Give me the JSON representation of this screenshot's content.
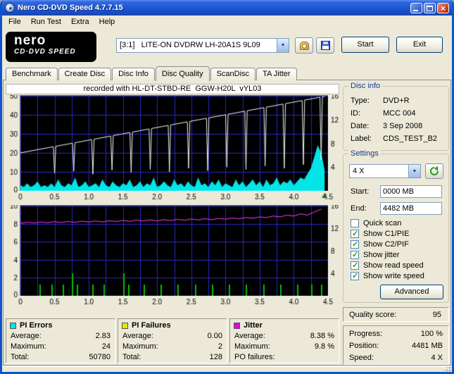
{
  "window": {
    "title": "Nero CD-DVD Speed 4.7.7.15"
  },
  "menu": {
    "items": [
      "File",
      "Run Test",
      "Extra",
      "Help"
    ]
  },
  "toolbar": {
    "logo_top": "nero",
    "logo_bottom": "CD·DVD SPEED",
    "drive_selector": "[3:1]   LITE-ON DVDRW LH-20A1S 9L09",
    "start_label": "Start",
    "exit_label": "Exit"
  },
  "tabs": [
    "Benchmark",
    "Create Disc",
    "Disc Info",
    "Disc Quality",
    "ScanDisc",
    "TA Jitter"
  ],
  "chart_header": "recorded with HL-DT-STBD-RE  GGW-H20L  vYL03",
  "disc_info": {
    "title": "Disc info",
    "rows": [
      {
        "label": "Type:",
        "value": "DVD+R"
      },
      {
        "label": "ID:",
        "value": "MCC 004"
      },
      {
        "label": "Date:",
        "value": "3 Sep 2008"
      },
      {
        "label": "Label:",
        "value": "CDS_TEST_B2"
      }
    ]
  },
  "settings": {
    "title": "Settings",
    "speed_selector": "4 X",
    "start_label": "Start:",
    "start_value": "0000 MB",
    "end_label": "End:",
    "end_value": "4482 MB",
    "checkboxes": [
      {
        "label": "Quick scan",
        "checked": false
      },
      {
        "label": "Show C1/PIE",
        "checked": true
      },
      {
        "label": "Show C2/PIF",
        "checked": true
      },
      {
        "label": "Show jitter",
        "checked": true
      },
      {
        "label": "Show read speed",
        "checked": true
      },
      {
        "label": "Show write speed",
        "checked": true
      }
    ],
    "advanced_label": "Advanced"
  },
  "quality": {
    "label": "Quality score:",
    "value": "95"
  },
  "progress": {
    "rows": [
      {
        "label": "Progress:",
        "value": "100 %"
      },
      {
        "label": "Position:",
        "value": "4481 MB"
      },
      {
        "label": "Speed:",
        "value": "4 X"
      }
    ]
  },
  "stats_panels": [
    {
      "name": "PI Errors",
      "color": "#00E6E6",
      "rows": [
        {
          "label": "Average:",
          "value": "2.83"
        },
        {
          "label": "Maximum:",
          "value": "24"
        },
        {
          "label": "Total:",
          "value": "50780"
        }
      ]
    },
    {
      "name": "PI Failures",
      "color": "#E6E600",
      "rows": [
        {
          "label": "Average:",
          "value": "0.00"
        },
        {
          "label": "Maximum:",
          "value": "2"
        },
        {
          "label": "Total:",
          "value": "128"
        }
      ]
    },
    {
      "name": "Jitter",
      "color": "#E600E6",
      "rows": [
        {
          "label": "Average:",
          "value": "8.38 %"
        },
        {
          "label": "Maximum:",
          "value": "9.8 %"
        },
        {
          "label": "PO failures:",
          "value": ""
        }
      ]
    }
  ],
  "chart_data": [
    {
      "type": "area+line",
      "title": "PI Errors / write speed vs disc position (GB)",
      "x_range": [
        0,
        4.5
      ],
      "x_ticks": [
        "0",
        "0.5",
        "1.0",
        "1.5",
        "2.0",
        "2.5",
        "3.0",
        "3.5",
        "4.0",
        "4.5"
      ],
      "y_left": {
        "name": "PI Errors",
        "range": [
          0,
          50
        ],
        "ticks": [
          0,
          10,
          20,
          30,
          40,
          50
        ]
      },
      "y_right": {
        "name": "Write speed (X)",
        "range": [
          0,
          16
        ],
        "ticks": [
          4,
          8,
          12,
          16
        ]
      },
      "grid": {
        "color": "#2828C8",
        "x_step": 0.25,
        "y_step": 10
      },
      "marker": {
        "x": 4.45,
        "color": "#1E6E1E"
      },
      "series": [
        {
          "name": "PI Errors",
          "type": "area",
          "axis": "left",
          "color": "#00E6E6",
          "x_start": 0,
          "x_step": 0.05,
          "values": [
            3,
            2,
            4,
            2,
            3,
            5,
            2,
            3,
            2,
            4,
            2,
            6,
            3,
            2,
            4,
            3,
            7,
            2,
            3,
            5,
            2,
            3,
            4,
            2,
            6,
            3,
            2,
            5,
            3,
            2,
            4,
            3,
            6,
            2,
            3,
            5,
            2,
            4,
            3,
            7,
            2,
            3,
            5,
            3,
            2,
            6,
            3,
            4,
            2,
            5,
            3,
            2,
            7,
            3,
            4,
            2,
            5,
            3,
            6,
            2,
            4,
            3,
            2,
            6,
            3,
            5,
            2,
            4,
            6,
            3,
            5,
            2,
            6,
            3,
            4,
            7,
            3,
            5,
            4,
            6,
            3,
            5,
            7,
            6,
            9,
            12,
            18,
            24,
            20,
            11
          ]
        },
        {
          "name": "Write speed",
          "type": "speedline",
          "axis": "right",
          "color": "#F5F5F5",
          "start": [
            0,
            6.4
          ],
          "end": [
            4.45,
            15.9
          ],
          "dips": [
            [
              0.5,
              3.0
            ],
            [
              0.78,
              3.3
            ],
            [
              1.06,
              2.8
            ],
            [
              1.34,
              3.5
            ],
            [
              1.62,
              3.1
            ],
            [
              1.9,
              3.6
            ],
            [
              2.18,
              3.2
            ],
            [
              2.46,
              3.8
            ],
            [
              2.74,
              3.4
            ],
            [
              3.02,
              4.0
            ],
            [
              3.3,
              3.6
            ],
            [
              3.58,
              4.2
            ],
            [
              3.86,
              3.8
            ],
            [
              4.14,
              4.4
            ],
            [
              4.4,
              5.2
            ]
          ]
        }
      ]
    },
    {
      "type": "line+bars",
      "title": "Jitter / PI Failures vs disc position (GB)",
      "x_range": [
        0,
        4.5
      ],
      "x_ticks": [
        "0",
        "0.5",
        "1.0",
        "1.5",
        "2.0",
        "2.5",
        "3.0",
        "3.5",
        "4.0",
        "4.5"
      ],
      "y_left": {
        "name": "Jitter (%)",
        "range": [
          0,
          10
        ],
        "ticks": [
          0,
          2,
          4,
          6,
          8,
          10
        ]
      },
      "y_right": {
        "name": "Speed (X)",
        "range": [
          0,
          16
        ],
        "ticks": [
          4,
          8,
          12,
          16
        ]
      },
      "grid": {
        "color": "#2828C8",
        "x_step": 0.25,
        "y_step": 2
      },
      "series": [
        {
          "name": "PI Failures",
          "type": "bars",
          "axis": "left",
          "color": "#00BE00",
          "scale_max": 8,
          "points": [
            [
              0.28,
              1
            ],
            [
              0.45,
              1
            ],
            [
              0.62,
              1
            ],
            [
              0.75,
              2
            ],
            [
              0.82,
              1
            ],
            [
              1.05,
              1
            ],
            [
              1.22,
              1
            ],
            [
              1.5,
              2
            ],
            [
              1.58,
              1
            ],
            [
              1.8,
              1
            ],
            [
              2.05,
              1
            ],
            [
              2.3,
              1
            ],
            [
              2.55,
              1
            ],
            [
              2.8,
              1
            ],
            [
              3.05,
              1
            ],
            [
              3.3,
              1
            ],
            [
              3.55,
              1
            ],
            [
              3.8,
              1
            ],
            [
              4.05,
              1
            ],
            [
              4.25,
              1
            ],
            [
              4.4,
              1
            ]
          ]
        },
        {
          "name": "Jitter",
          "type": "line",
          "axis": "left",
          "color": "#FF3CFF",
          "x_start": 0,
          "x_step": 0.1,
          "values": [
            8.05,
            8.15,
            8.08,
            8.18,
            8.1,
            8.22,
            8.12,
            8.25,
            8.15,
            8.28,
            8.18,
            8.3,
            8.2,
            8.33,
            8.24,
            8.36,
            8.26,
            8.4,
            8.3,
            8.42,
            8.32,
            8.45,
            8.35,
            8.48,
            8.38,
            8.52,
            8.42,
            8.55,
            8.45,
            8.58,
            8.5,
            8.62,
            8.55,
            8.68,
            8.6,
            8.75,
            8.68,
            8.85,
            8.75,
            8.95,
            8.85,
            9.1,
            8.95,
            9.3,
            9.6
          ]
        }
      ]
    }
  ]
}
